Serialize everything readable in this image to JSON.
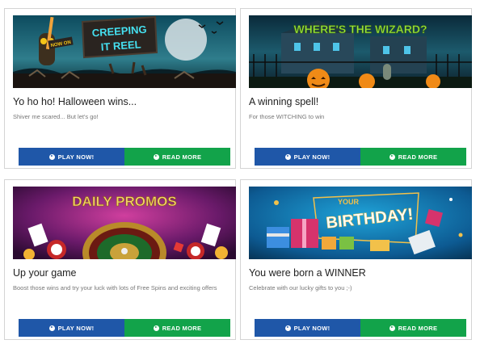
{
  "colors": {
    "play_button": "#1f57a8",
    "more_button": "#12a34a",
    "card_border": "#d4d4d4",
    "title_text": "#222222",
    "subtitle_text": "#777777"
  },
  "cards": [
    {
      "banner": {
        "badge": "NOW ON",
        "line1": "CREEPING",
        "line2": "IT REEL"
      },
      "title": "Yo ho ho! Halloween wins...",
      "subtitle": "Shiver me scared... But let's go!",
      "play_label": "PLAY NOW!",
      "more_label": "READ MORE",
      "play_icon": "play-circle-icon",
      "more_icon": "arrow-circle-icon"
    },
    {
      "banner": {
        "headline": "WHERE'S THE WIZARD?"
      },
      "title": "A winning spell!",
      "subtitle": "For those WITCHING to win",
      "play_label": "PLAY NOW!",
      "more_label": "READ MORE",
      "play_icon": "play-circle-icon",
      "more_icon": "arrow-circle-icon"
    },
    {
      "banner": {
        "headline": "DAILY PROMOS"
      },
      "title": "Up your game",
      "subtitle": "Boost those wins and try your luck with lots of Free Spins and exciting offers",
      "play_label": "PLAY NOW!",
      "more_label": "READ MORE",
      "play_icon": "play-circle-icon",
      "more_icon": "arrow-circle-icon"
    },
    {
      "banner": {
        "line1": "YOUR",
        "line2": "BIRTHDAY!"
      },
      "title": "You were born a WINNER",
      "subtitle": "Celebrate with our lucky gifts to you ;-)",
      "play_label": "PLAY NOW!",
      "more_label": "READ MORE",
      "play_icon": "play-circle-icon",
      "more_icon": "arrow-circle-icon"
    }
  ]
}
